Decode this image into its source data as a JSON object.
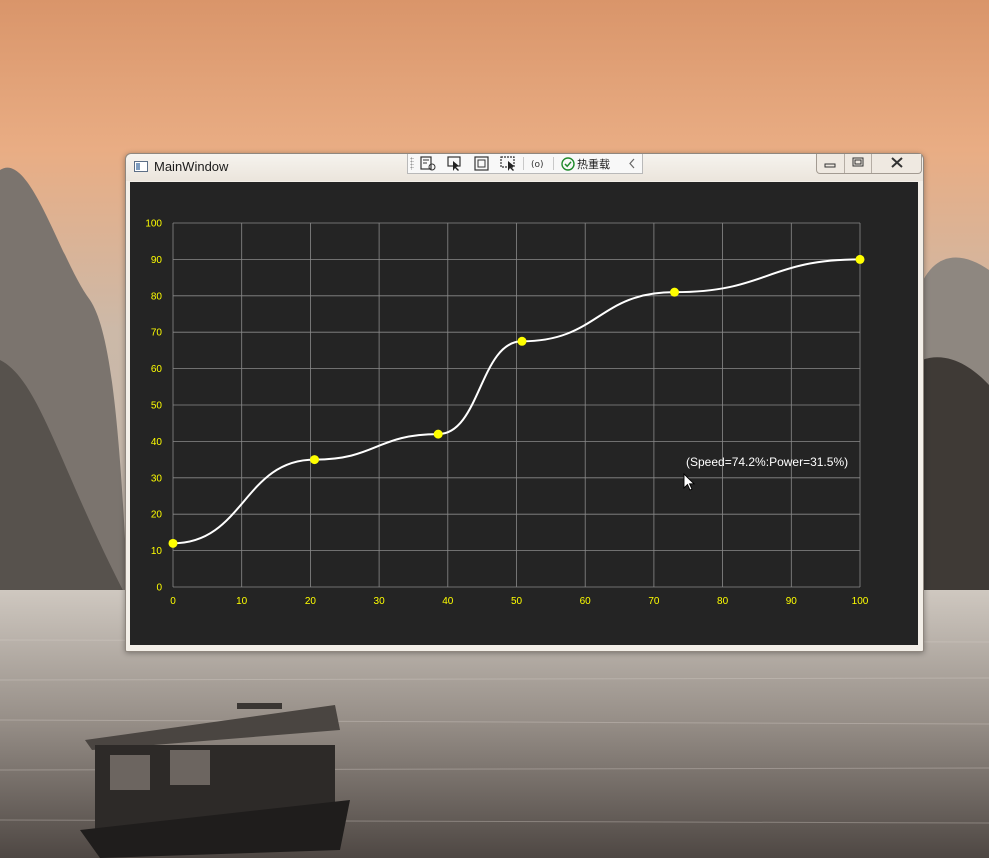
{
  "window": {
    "title": "MainWindow"
  },
  "debug_toolbar": {
    "hot_reload_label": "热重载",
    "tools": [
      "select-element-icon",
      "pointer-icon",
      "display-layout-icon",
      "track-focus-icon",
      "binding-icon"
    ]
  },
  "colors": {
    "plot_background": "#242424",
    "grid": "#8a8a8a",
    "axis_labels": "#ffff00",
    "curve": "#ffffff",
    "points": "#ffff00",
    "tooltip_text": "#ffffff"
  },
  "tooltip": {
    "text": "(Speed=74.2%:Power=31.5%)"
  },
  "chart_data": {
    "type": "line",
    "smooth": true,
    "title": "",
    "xlabel": "",
    "ylabel": "",
    "xlim": [
      0,
      100
    ],
    "ylim": [
      0,
      100
    ],
    "xticks": [
      0,
      10,
      20,
      30,
      40,
      50,
      60,
      70,
      80,
      90,
      100
    ],
    "yticks": [
      0,
      10,
      20,
      30,
      40,
      50,
      60,
      70,
      80,
      90,
      100
    ],
    "grid": true,
    "legend": "none",
    "series": [
      {
        "x": [
          0,
          20.6,
          38.6,
          50.8,
          73,
          100
        ],
        "y": [
          12,
          35,
          42,
          67.5,
          81,
          90
        ]
      }
    ]
  }
}
